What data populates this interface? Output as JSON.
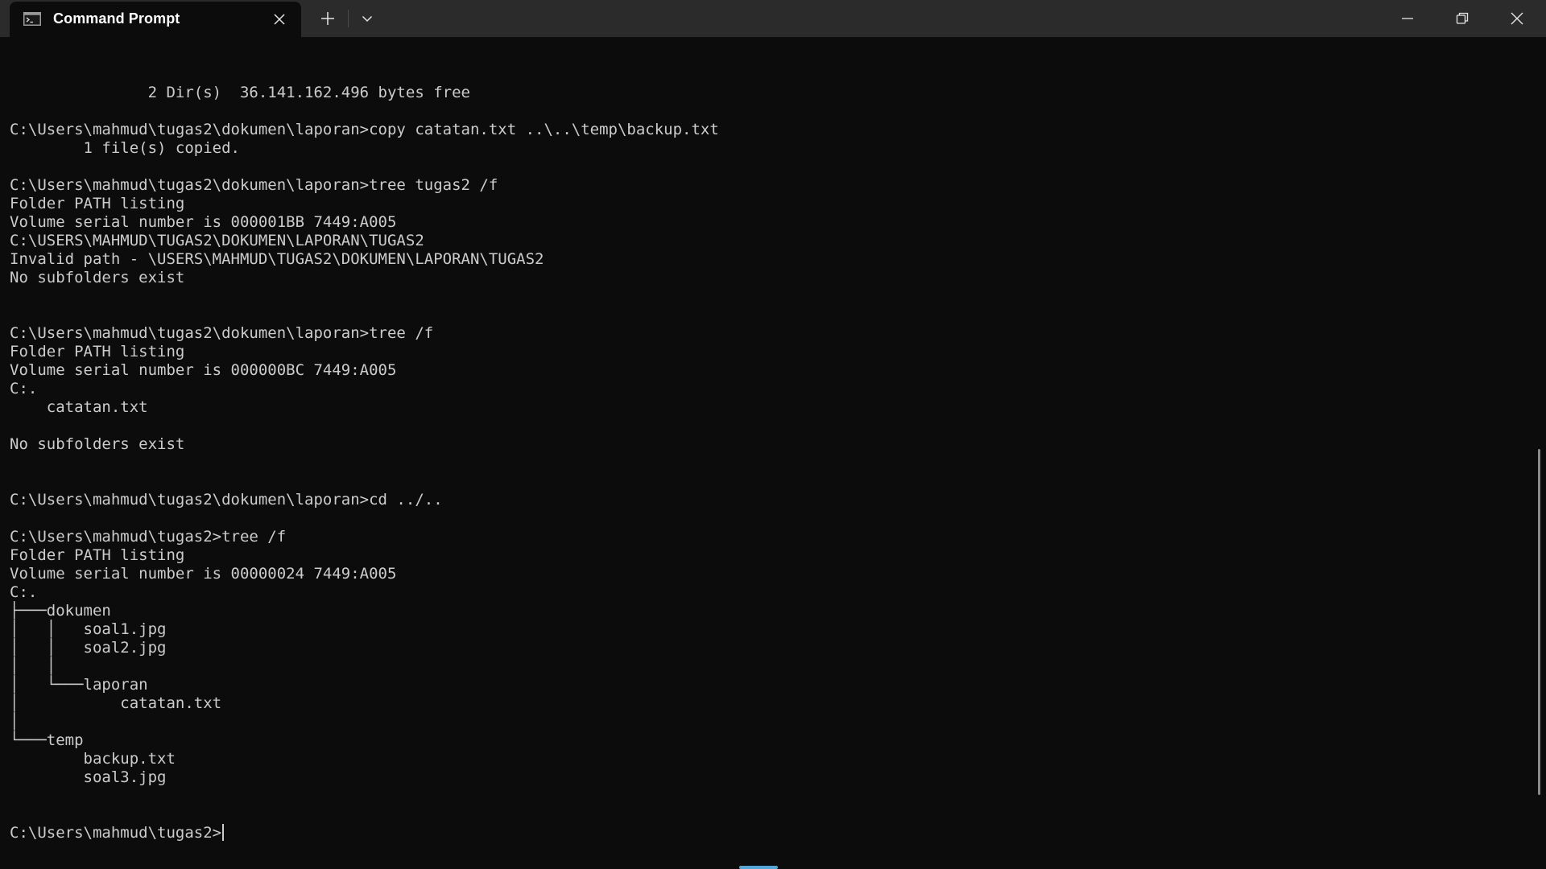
{
  "window": {
    "tab_title": "Command Prompt",
    "tab_icon": "cmd-icon",
    "new_tab_icon": "plus-icon",
    "dropdown_icon": "chevron-down-icon",
    "minimize_icon": "minimize-icon",
    "maximize_icon": "restore-icon",
    "close_icon": "close-icon"
  },
  "terminal": {
    "lines": [
      "               2 Dir(s)  36.141.162.496 bytes free",
      "",
      "C:\\Users\\mahmud\\tugas2\\dokumen\\laporan>copy catatan.txt ..\\..\\temp\\backup.txt",
      "        1 file(s) copied.",
      "",
      "C:\\Users\\mahmud\\tugas2\\dokumen\\laporan>tree tugas2 /f",
      "Folder PATH listing",
      "Volume serial number is 000001BB 7449:A005",
      "C:\\USERS\\MAHMUD\\TUGAS2\\DOKUMEN\\LAPORAN\\TUGAS2",
      "Invalid path - \\USERS\\MAHMUD\\TUGAS2\\DOKUMEN\\LAPORAN\\TUGAS2",
      "No subfolders exist",
      "",
      "",
      "C:\\Users\\mahmud\\tugas2\\dokumen\\laporan>tree /f",
      "Folder PATH listing",
      "Volume serial number is 000000BC 7449:A005",
      "C:.",
      "    catatan.txt",
      "",
      "No subfolders exist",
      "",
      "",
      "C:\\Users\\mahmud\\tugas2\\dokumen\\laporan>cd ../..",
      "",
      "C:\\Users\\mahmud\\tugas2>tree /f",
      "Folder PATH listing",
      "Volume serial number is 00000024 7449:A005",
      "C:.",
      "├───dokumen",
      "│   │   soal1.jpg",
      "│   │   soal2.jpg",
      "│   │",
      "│   └───laporan",
      "│           catatan.txt",
      "│",
      "└───temp",
      "        backup.txt",
      "        soal3.jpg",
      "",
      ""
    ],
    "prompt": "C:\\Users\\mahmud\\tugas2>"
  },
  "colors": {
    "background": "#0c0c0c",
    "titlebar": "#2b2b2b",
    "text": "#cccccc",
    "accent": "#4fa8d8"
  }
}
